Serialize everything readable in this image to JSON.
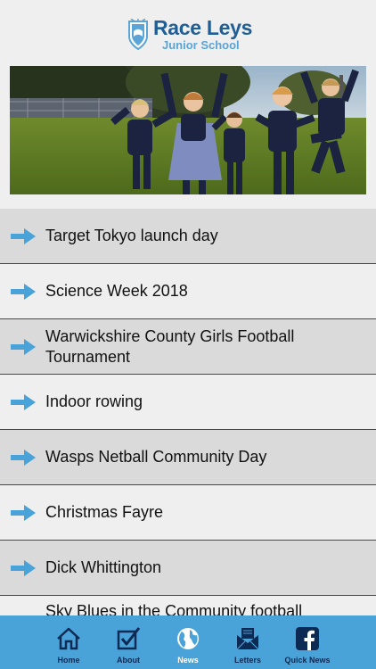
{
  "header": {
    "school_name": "Race Leys",
    "school_sub": "Junior School"
  },
  "news_items": [
    {
      "label": "Target Tokyo launch day"
    },
    {
      "label": "Science Week 2018"
    },
    {
      "label": "Warwickshire County Girls Football Tournament"
    },
    {
      "label": "Indoor rowing"
    },
    {
      "label": "Wasps Netball Community Day"
    },
    {
      "label": "Christmas Fayre"
    },
    {
      "label": "Dick Whittington"
    },
    {
      "label": "Sky Blues in the Community football"
    }
  ],
  "tabs": [
    {
      "label": "Home",
      "icon": "home-icon"
    },
    {
      "label": "About",
      "icon": "checkbox-icon"
    },
    {
      "label": "News",
      "icon": "globe-icon"
    },
    {
      "label": "Letters",
      "icon": "envelope-icon"
    },
    {
      "label": "Quick News",
      "icon": "facebook-icon"
    }
  ],
  "active_tab": "News",
  "colors": {
    "accent": "#4aa3d8",
    "brand": "#1f5e97",
    "arrow": "#4aa3d8",
    "row_dark": "#dadada",
    "row_light": "#efefef"
  }
}
